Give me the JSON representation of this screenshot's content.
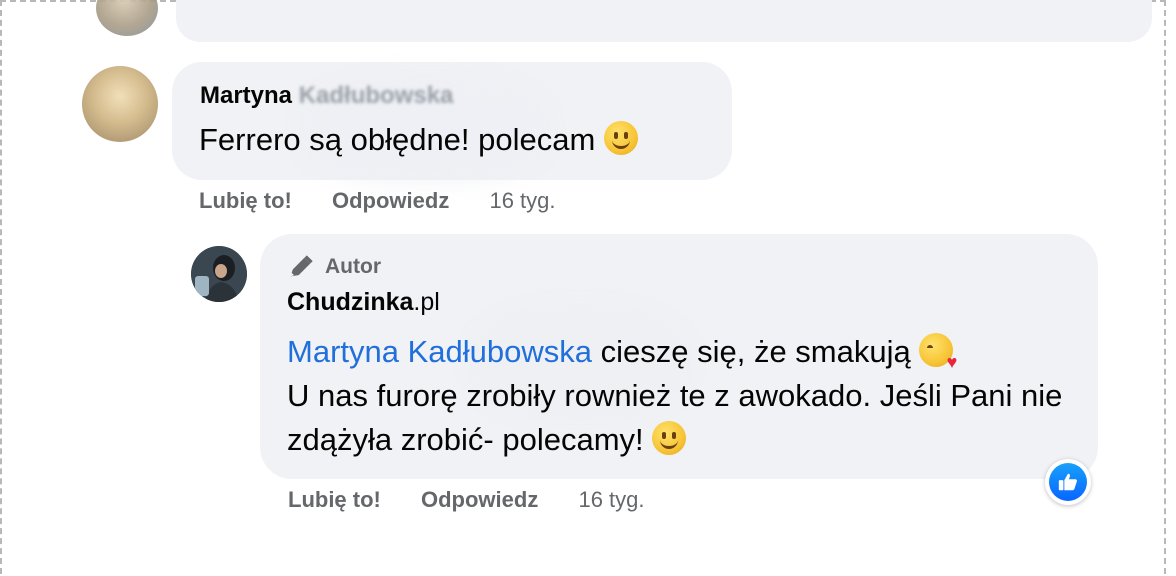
{
  "comments": [
    {
      "author_visible": "Martyna",
      "author_blurred": "Kadłubowska",
      "text_parts": [
        "Ferrero są obłędne! polecam"
      ],
      "emoji": "slightly-smiling-face",
      "actions": {
        "like": "Lubię to!",
        "reply": "Odpowiedz",
        "time": "16 tyg."
      }
    },
    {
      "badge": "Autor",
      "author": "Chudzinka",
      "author_tld": ".pl",
      "mention": "Martyna Kadłubowska",
      "text_line_1": " cieszę się, że smakują",
      "emoji_1": "face-blowing-a-kiss",
      "text_line_2": "U nas furorę zrobiły rownież te z awokado. Jeśli Pani nie zdążyła zrobić- polecamy!",
      "emoji_2": "slightly-smiling-face",
      "reaction": "like-reaction-icon",
      "actions": {
        "like": "Lubię to!",
        "reply": "Odpowiedz",
        "time": "16 tyg."
      }
    }
  ],
  "colors": {
    "bubble": "#f0f2f5",
    "mention": "#216fdb",
    "meta": "#65676b",
    "like_blue": "#0866ff"
  }
}
